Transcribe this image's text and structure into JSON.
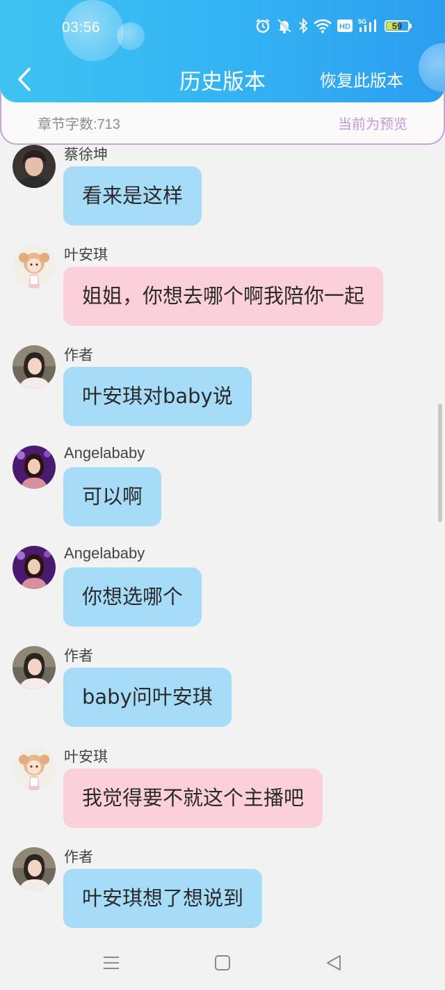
{
  "status_bar": {
    "time": "03:56",
    "battery_percent": 59,
    "battery_label": "59",
    "hd_label": "HD",
    "network_label": "5G"
  },
  "header": {
    "title": "历史版本",
    "restore_label": "恢复此版本",
    "back_icon": "chevron-left-icon"
  },
  "subbar": {
    "word_count": "章节字数:713",
    "preview_status": "当前为预览"
  },
  "colors": {
    "header_blue": "#33b2f3",
    "bubble_blue": "#a7dcf8",
    "bubble_pink": "#fbd0db",
    "preview_purple": "#c696dc"
  },
  "messages": [
    {
      "sender": "蔡徐坤",
      "text": "看来是这样",
      "color": "blue",
      "avatar": "male-portrait"
    },
    {
      "sender": "叶安琪",
      "text": "姐姐，你想去哪个啊我陪你一起",
      "color": "pink",
      "avatar": "cartoon-girl"
    },
    {
      "sender": "作者",
      "text": "叶安琪对baby说",
      "color": "blue",
      "avatar": "author-portrait"
    },
    {
      "sender": "Angelababy",
      "text": "可以啊",
      "color": "blue",
      "avatar": "angelababy-portrait"
    },
    {
      "sender": "Angelababy",
      "text": "你想选哪个",
      "color": "blue",
      "avatar": "angelababy-portrait"
    },
    {
      "sender": "作者",
      "text": "baby问叶安琪",
      "color": "blue",
      "avatar": "author-portrait"
    },
    {
      "sender": "叶安琪",
      "text": "我觉得要不就这个主播吧",
      "color": "pink",
      "avatar": "cartoon-girl"
    },
    {
      "sender": "作者",
      "text": "叶安琪想了想说到",
      "color": "blue",
      "avatar": "author-portrait"
    }
  ],
  "nav_bar": {
    "icons": [
      "menu-icon",
      "home-icon",
      "back-triangle-icon"
    ]
  }
}
